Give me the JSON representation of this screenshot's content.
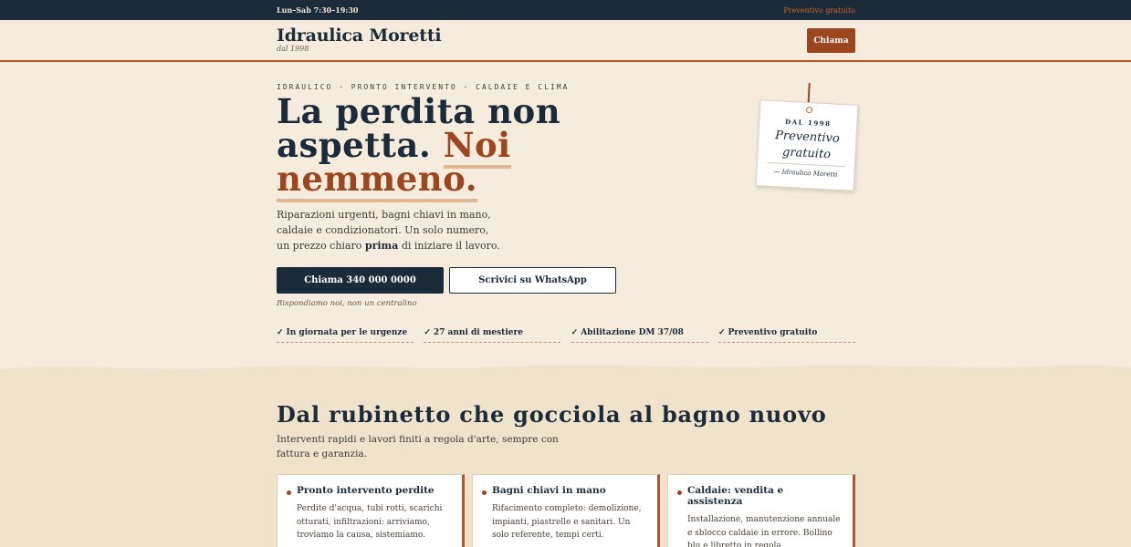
{
  "topbar": {
    "hours": "Lun–Sab 7:30–19:30",
    "quote_link": "Preventivo gratuito"
  },
  "header": {
    "brand": "Idraulica Moretti",
    "since": "dal 1998",
    "call_button": "Chiama"
  },
  "hero": {
    "kicker": "IDRAULICO · PRONTO INTERVENTO · CALDAIE E CLIMA",
    "headline_part1": "La perdita non aspetta.",
    "headline_accent_1": "Noi",
    "headline_accent_2": "nemmeno.",
    "lead_text": "Riparazioni urgenti, bagni chiavi in mano, caldaie e condizionatori. Un solo numero, un prezzo chiaro",
    "lead_bold": "prima",
    "lead_end": "di iniziare il lavoro.",
    "primary_button": "Chiama 340 000 0000",
    "secondary_button": "Scrivici su WhatsApp",
    "note": "Rispondiamo noi, non un centralino",
    "checks": [
      "In giornata per le urgenze",
      "27 anni di mestiere",
      "Abilitazione DM 37/08",
      "Preventivo gratuito"
    ],
    "check_mark": "✓"
  },
  "tag_card": {
    "since": "DAL 1998",
    "line1": "Preventivo",
    "line2": "gratuito",
    "signature": "— Idraulica Moretti"
  },
  "services": {
    "title": "Dal rubinetto che gocciola al bagno nuovo",
    "subtitle": "Interventi rapidi e lavori finiti a regola d'arte, sempre con fattura e garanzia.",
    "cards": [
      {
        "title": "Pronto intervento perdite",
        "text": "Perdite d'acqua, tubi rotti, scarichi otturati, infiltrazioni: arriviamo, troviamo la causa, sistemiamo."
      },
      {
        "title": "Bagni chiavi in mano",
        "text": "Rifacimento completo: demolizione, impianti, piastrelle e sanitari. Un solo referente, tempi certi."
      },
      {
        "title": "Caldaie: vendita e assistenza",
        "text": "Installazione, manutenzione annuale e sblocco caldaie in errore. Bollino blu e libretto in regola."
      }
    ]
  },
  "colors": {
    "navy": "#1c2b3a",
    "rust": "#9c4620",
    "cream": "#f6ecdd"
  }
}
